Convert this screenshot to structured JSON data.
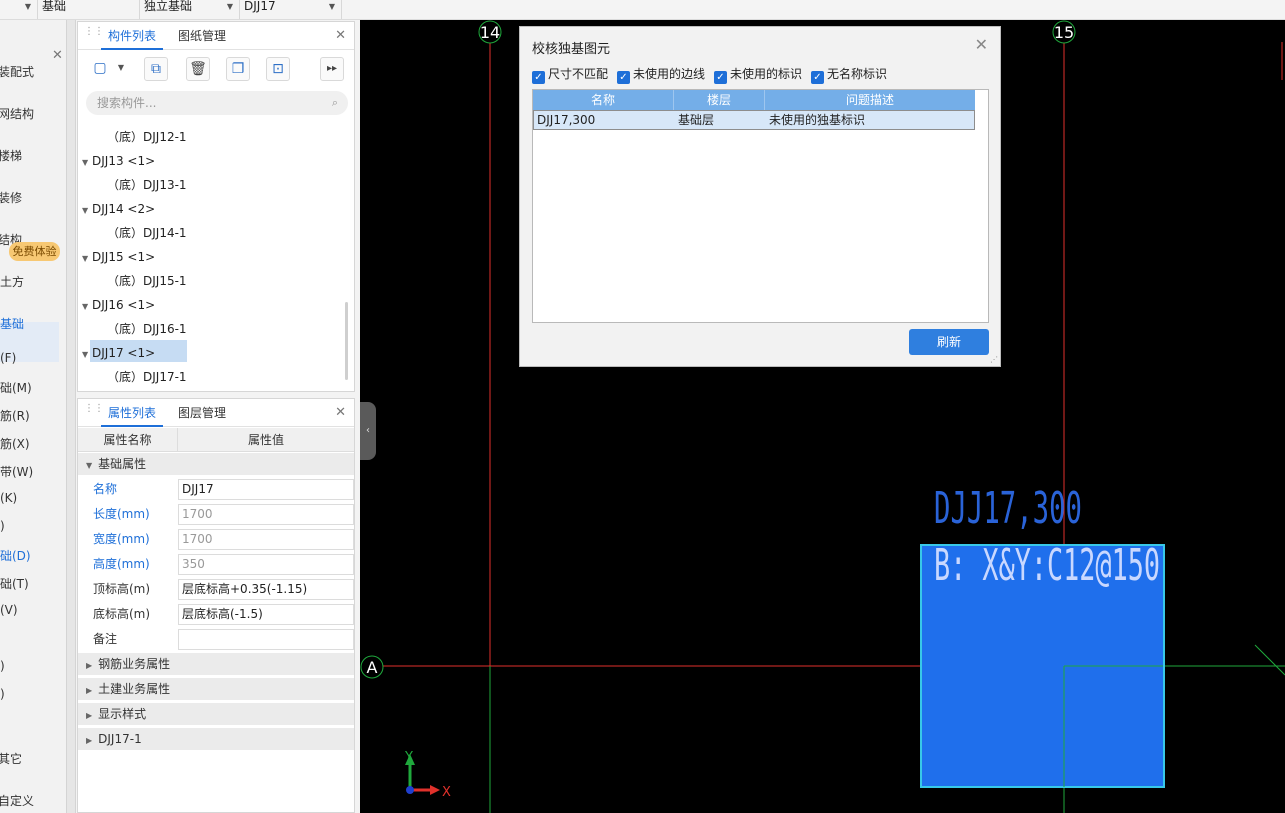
{
  "topbar": {
    "selectors": [
      {
        "value": "基础"
      },
      {
        "value": "独立基础"
      },
      {
        "value": "DJJ17"
      }
    ]
  },
  "leftnav": {
    "items": [
      {
        "label": "装配式"
      },
      {
        "label": "网结构"
      },
      {
        "label": "楼梯"
      },
      {
        "label": "装修"
      },
      {
        "label": "结构"
      },
      {
        "label": "土方"
      },
      {
        "label": "基础"
      },
      {
        "label": "(F)"
      },
      {
        "label": "础(M)"
      },
      {
        "label": "筋(R)"
      },
      {
        "label": "筋(X)"
      },
      {
        "label": "带(W)"
      },
      {
        "label": "(K)"
      },
      {
        "label": ")"
      },
      {
        "label": "础(D)"
      },
      {
        "label": "础(T)"
      },
      {
        "label": "(V)"
      },
      {
        "label": ")"
      },
      {
        "label": ")"
      },
      {
        "label": "其它"
      },
      {
        "label": "自定义"
      }
    ],
    "promo": "免费体验"
  },
  "component_panel": {
    "tabs": [
      "构件列表",
      "图纸管理"
    ],
    "search_placeholder": "搜索构件...",
    "tree": [
      {
        "label": "（底）DJJ12-1",
        "level": 2
      },
      {
        "label": "DJJ13 <1>",
        "level": 1
      },
      {
        "label": "（底）DJJ13-1",
        "level": 2
      },
      {
        "label": "DJJ14 <2>",
        "level": 1
      },
      {
        "label": "（底）DJJ14-1",
        "level": 2
      },
      {
        "label": "DJJ15 <1>",
        "level": 1
      },
      {
        "label": "（底）DJJ15-1",
        "level": 2
      },
      {
        "label": "DJJ16 <1>",
        "level": 1
      },
      {
        "label": "（底）DJJ16-1",
        "level": 2
      },
      {
        "label": "DJJ17 <1>",
        "level": 1
      },
      {
        "label": "（底）DJJ17-1",
        "level": 2
      }
    ]
  },
  "property_panel": {
    "tabs": [
      "属性列表",
      "图层管理"
    ],
    "columns": [
      "属性名称",
      "属性值"
    ],
    "group_basic": "基础属性",
    "rows": [
      {
        "name": "名称",
        "value": "DJJ17"
      },
      {
        "name": "长度(mm)",
        "value": "1700"
      },
      {
        "name": "宽度(mm)",
        "value": "1700"
      },
      {
        "name": "高度(mm)",
        "value": "350"
      },
      {
        "name": "顶标高(m)",
        "value": "层底标高+0.35(-1.15)"
      },
      {
        "name": "底标高(m)",
        "value": "层底标高(-1.5)"
      },
      {
        "name": "备注",
        "value": ""
      }
    ],
    "groups": [
      "钢筋业务属性",
      "土建业务属性",
      "显示样式",
      "DJJ17-1"
    ]
  },
  "canvas": {
    "axis_labels": [
      "14",
      "15",
      "A"
    ],
    "label_line1": "DJJ17,300",
    "label_line2": "B: X&Y:C12@150",
    "ucs_x": "X",
    "ucs_y": "Y",
    "colors": {
      "background": "#000000",
      "axis_red": "#e0312b",
      "axis_green": "#1fa83c",
      "footing_fill": "#1f6fec",
      "footing_border": "#38c8e8",
      "text_blue": "#2a63d8"
    }
  },
  "dialog": {
    "title": "校核独基图元",
    "checkboxes": [
      "尺寸不匹配",
      "未使用的边线",
      "未使用的标识",
      "无名称标识"
    ],
    "columns": [
      "名称",
      "楼层",
      "问题描述"
    ],
    "rows": [
      {
        "name": "DJJ17,300",
        "floor": "基础层",
        "desc": "未使用的独基标识"
      }
    ],
    "refresh_label": "刷新"
  }
}
